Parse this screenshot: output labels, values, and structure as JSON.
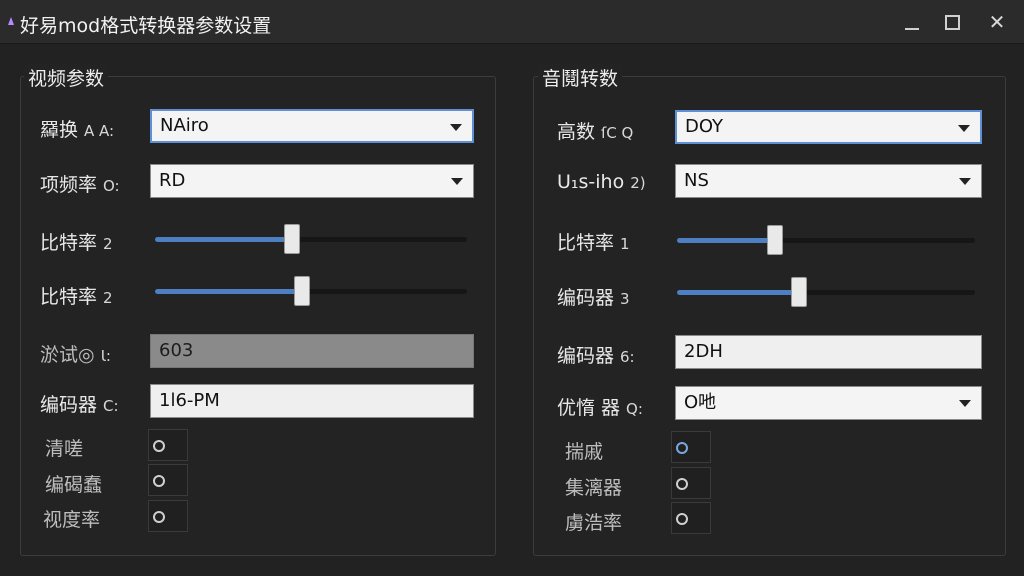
{
  "window": {
    "title": "好易mod格式转换器参数设置",
    "controls": {
      "minimize": "minimize",
      "maximize": "maximize",
      "close": "✕"
    }
  },
  "video": {
    "group_title": "视频参数",
    "fields": [
      {
        "label": "羄换",
        "sub": "A A:",
        "value": "NAiro"
      },
      {
        "label": "项频率",
        "sub": "O:",
        "value": "RD"
      }
    ],
    "sliders": [
      {
        "label": "比特率",
        "sub": "2",
        "level": 0.44
      },
      {
        "label": "比特率",
        "sub": "2",
        "level": 0.47
      }
    ],
    "text_fields": [
      {
        "label": "淤试◎",
        "sub": "Ɩ:",
        "value": "603",
        "disabled": true
      },
      {
        "label": "编码器",
        "sub": "C:",
        "value": "1l6-PM",
        "disabled": false
      }
    ],
    "options": [
      "清嗟",
      "编碣蠢",
      "视度率"
    ]
  },
  "audio": {
    "group_title": "音鬩转数",
    "fields": [
      {
        "label": "高数",
        "sub": "ſC Q",
        "value": "DOY"
      },
      {
        "label": "U₁s-iho",
        "sub": "2)",
        "value": "NS"
      }
    ],
    "sliders": [
      {
        "label": "比特率",
        "sub": "1",
        "level": 0.33
      },
      {
        "label": "编码器",
        "sub": "3",
        "level": 0.41
      }
    ],
    "text_field": {
      "label": "编码器",
      "sub": "6:",
      "value": "2DH"
    },
    "select_field": {
      "label": "优惰 器",
      "sub": "Q:",
      "value": "O吔"
    },
    "options": [
      "揣戚",
      "集漓器",
      "虜浩率"
    ]
  },
  "colors": {
    "accent": "#4d7fc2",
    "background": "#222222",
    "titlebar": "#2b2b2b"
  }
}
